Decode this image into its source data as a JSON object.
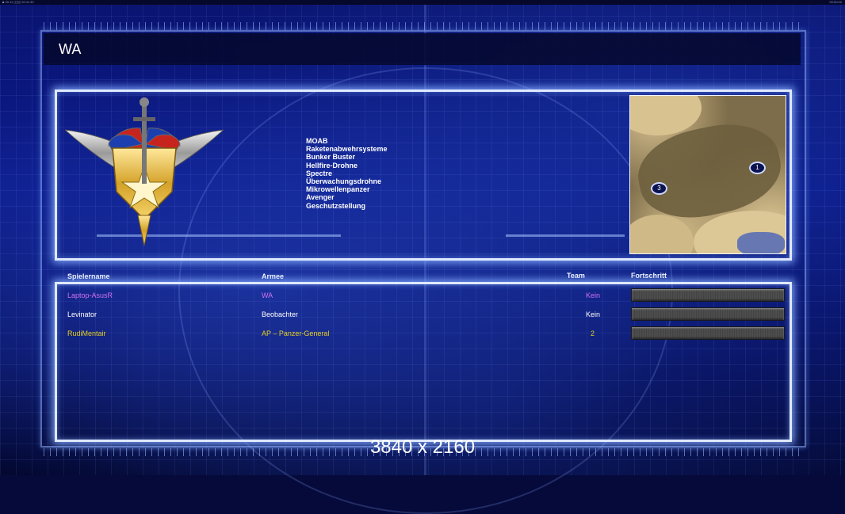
{
  "window": {
    "title": "WA",
    "resolution_label": "3840 x 2160",
    "clock_left": "■ 20:11 ▯▯▯▯ 20:11:30",
    "clock_right": "00:00:00"
  },
  "generals_powers": [
    "MOAB",
    "Raketenabwehrsysteme",
    "Bunker Buster",
    "Hellfire-Drohne",
    "Spectre",
    "Überwachungsdrohne",
    "Mikrowellenpanzer",
    "Avenger",
    "Geschutzstellung"
  ],
  "map": {
    "markers": [
      {
        "label": "1"
      },
      {
        "label": "3"
      }
    ]
  },
  "table": {
    "headers": {
      "player": "Spielername",
      "army": "Armee",
      "team": "Team",
      "progress": "Fortschritt"
    },
    "rows": [
      {
        "player": "Laptop-AsusR",
        "army": "WA",
        "team": "Kein",
        "color": "#d070f0"
      },
      {
        "player": "Levinator",
        "army": "Beobachter",
        "team": "Kein",
        "color": "#ffffff"
      },
      {
        "player": "RudiMentair",
        "army": "AP – Panzer-General",
        "team": "2",
        "color": "#e8d020"
      }
    ]
  },
  "colors": {
    "background": "#0b1a8a",
    "panel_border": "#dfe9ff",
    "emblem_red": "#c8241e",
    "emblem_blue": "#1c3fb0",
    "emblem_gold": "#e6b830"
  }
}
